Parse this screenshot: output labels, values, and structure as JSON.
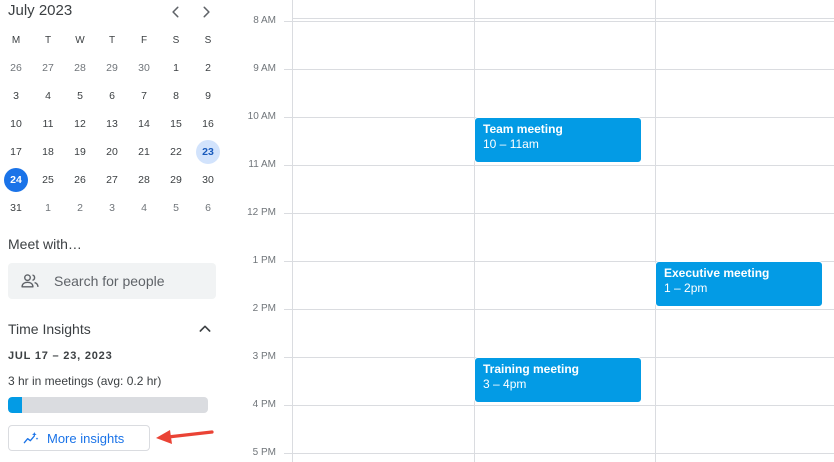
{
  "mini_calendar": {
    "month_title": "July 2023",
    "weekday_labels": [
      "M",
      "T",
      "W",
      "T",
      "F",
      "S",
      "S"
    ],
    "weeks": [
      [
        "26",
        "27",
        "28",
        "29",
        "30",
        "1",
        "2"
      ],
      [
        "3",
        "4",
        "5",
        "6",
        "7",
        "8",
        "9"
      ],
      [
        "10",
        "11",
        "12",
        "13",
        "14",
        "15",
        "16"
      ],
      [
        "17",
        "18",
        "19",
        "20",
        "21",
        "22",
        "23"
      ],
      [
        "24",
        "25",
        "26",
        "27",
        "28",
        "29",
        "30"
      ],
      [
        "31",
        "1",
        "2",
        "3",
        "4",
        "5",
        "6"
      ]
    ],
    "icons": {
      "prev": "chevron-left-icon",
      "next": "chevron-right-icon"
    }
  },
  "meet_with": {
    "title": "Meet with…",
    "search_placeholder": "Search for people",
    "icon": "people-icon"
  },
  "time_insights": {
    "title": "Time Insights",
    "range": "JUL 17 – 23, 2023",
    "meetings_summary": "3 hr in meetings (avg: 0.2 hr)",
    "progress_fraction": 0.07,
    "button_label": "More insights",
    "colors": {
      "fill": "#039be5",
      "track": "#dadce0",
      "button_text": "#1a73e8",
      "annotation_arrow": "#ea4335"
    }
  },
  "day_grid": {
    "hour_labels": [
      "8 AM",
      "9 AM",
      "10 AM",
      "11 AM",
      "12 PM",
      "1 PM",
      "2 PM",
      "3 PM",
      "4 PM",
      "5 PM"
    ],
    "events": [
      {
        "title": "Team meeting",
        "time": "10 – 11am"
      },
      {
        "title": "Executive meeting",
        "time": "1 – 2pm"
      },
      {
        "title": "Training meeting",
        "time": "3 – 4pm"
      }
    ],
    "event_color": "#039be5"
  }
}
